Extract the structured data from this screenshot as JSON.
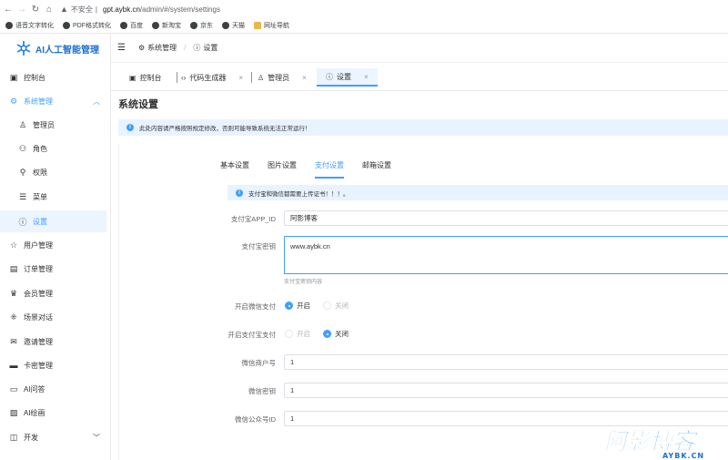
{
  "browser": {
    "security_label": "不安全",
    "url_host": "gpt.aybk.cn",
    "url_path": "/admin/#/system/settings",
    "bookmarks": [
      "语音文字转化",
      "PDF格式转化",
      "百度",
      "新淘宝",
      "京东",
      "天猫",
      "网址导航"
    ]
  },
  "sidebar": {
    "brand": "AI人工智能管理",
    "items": [
      {
        "label": "控制台",
        "icon": "monitor-icon"
      },
      {
        "label": "系统管理",
        "icon": "gear-icon"
      },
      {
        "label": "管理员",
        "icon": "user-admin-icon"
      },
      {
        "label": "角色",
        "icon": "role-icon"
      },
      {
        "label": "权限",
        "icon": "key-icon"
      },
      {
        "label": "菜单",
        "icon": "menu-list-icon"
      },
      {
        "label": "设置",
        "icon": "info-icon"
      },
      {
        "label": "用户管理",
        "icon": "star-icon"
      },
      {
        "label": "订单管理",
        "icon": "clipboard-icon"
      },
      {
        "label": "会员管理",
        "icon": "crown-icon"
      },
      {
        "label": "场景对话",
        "icon": "scene-icon"
      },
      {
        "label": "邀请管理",
        "icon": "mail-icon"
      },
      {
        "label": "卡密管理",
        "icon": "card-icon"
      },
      {
        "label": "AI问答",
        "icon": "chat-icon"
      },
      {
        "label": "AI绘画",
        "icon": "picture-icon"
      },
      {
        "label": "开发",
        "icon": "dev-icon"
      }
    ]
  },
  "header": {
    "breadcrumb": [
      "系统管理",
      "设置"
    ]
  },
  "tabs": [
    {
      "label": "控制台",
      "icon": "monitor-icon",
      "closable": false
    },
    {
      "label": "代码生成器",
      "icon": "code-icon",
      "closable": true
    },
    {
      "label": "管理员",
      "icon": "user-admin-icon",
      "closable": true
    },
    {
      "label": "设置",
      "icon": "info-icon",
      "closable": true,
      "active": true
    }
  ],
  "main": {
    "title": "系统设置",
    "notice": "此处内容请严格按照规定修改，否则可能导致系统无法正常运行！",
    "subtabs": [
      "基本设置",
      "图片设置",
      "支付设置",
      "邮箱设置"
    ],
    "active_subtab": 2,
    "pay_notice": "支付宝和微信都需要上传证书！！！。",
    "fields": {
      "alipay_app_id_label": "支付宝APP_ID",
      "alipay_app_id_value": "阿影博客",
      "alipay_key_label": "支付宝密钥",
      "alipay_key_value": "www.aybk.cn",
      "alipay_key_hint": "支付宝密钥内容",
      "wechat_pay_label": "开启微信支付",
      "wechat_pay_on": "开启",
      "wechat_pay_off": "关闭",
      "wechat_pay_enabled": true,
      "alipay_pay_label": "开启支付宝支付",
      "alipay_pay_on": "开启",
      "alipay_pay_off": "关闭",
      "alipay_pay_enabled": false,
      "wechat_mch_label": "微信商户号",
      "wechat_mch_value": "1",
      "wechat_key_label": "微信密钥",
      "wechat_key_value": "1",
      "wechat_appid_label": "微信公众号ID",
      "wechat_appid_value": "1"
    }
  },
  "watermark": {
    "main_text": "阿影博客",
    "sub_text": "AYBK.CN"
  },
  "colors": {
    "primary": "#409eff",
    "brand": "#1f6fd1",
    "active_bg": "#ecf5ff",
    "alert_bg": "#e8f3ff"
  }
}
